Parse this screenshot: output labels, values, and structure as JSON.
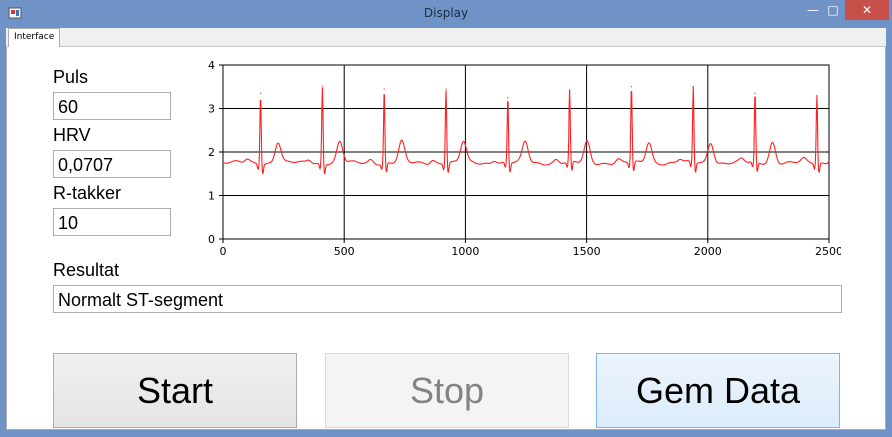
{
  "window": {
    "title": "Display"
  },
  "tabs": [
    {
      "label": "Interface"
    }
  ],
  "fields": {
    "puls": {
      "label": "Puls",
      "value": "60"
    },
    "hrv": {
      "label": "HRV",
      "value": "0,0707"
    },
    "rtakker": {
      "label": "R-takker",
      "value": "10"
    },
    "resultat": {
      "label": "Resultat",
      "value": "Normalt ST-segment"
    }
  },
  "buttons": {
    "start": "Start",
    "stop": "Stop",
    "gem": "Gem Data"
  },
  "colors": {
    "signal": "#ff2020",
    "grid": "#000000"
  },
  "chart_data": {
    "type": "line",
    "xlim": [
      0,
      2500
    ],
    "ylim": [
      0,
      4
    ],
    "xticks": [
      "0",
      "500",
      "1000",
      "1500",
      "2000",
      "2500"
    ],
    "yticks": [
      "0",
      "1",
      "2",
      "3",
      "4"
    ],
    "grid": true,
    "baseline": 1.75,
    "r_peaks": [
      {
        "x": 155,
        "y": 3.35
      },
      {
        "x": 410,
        "y": 3.5
      },
      {
        "x": 665,
        "y": 3.45
      },
      {
        "x": 920,
        "y": 3.45
      },
      {
        "x": 1175,
        "y": 3.25
      },
      {
        "x": 1430,
        "y": 3.4
      },
      {
        "x": 1685,
        "y": 3.5
      },
      {
        "x": 1940,
        "y": 3.5
      },
      {
        "x": 2195,
        "y": 3.35
      },
      {
        "x": 2450,
        "y": 3.3
      }
    ]
  }
}
